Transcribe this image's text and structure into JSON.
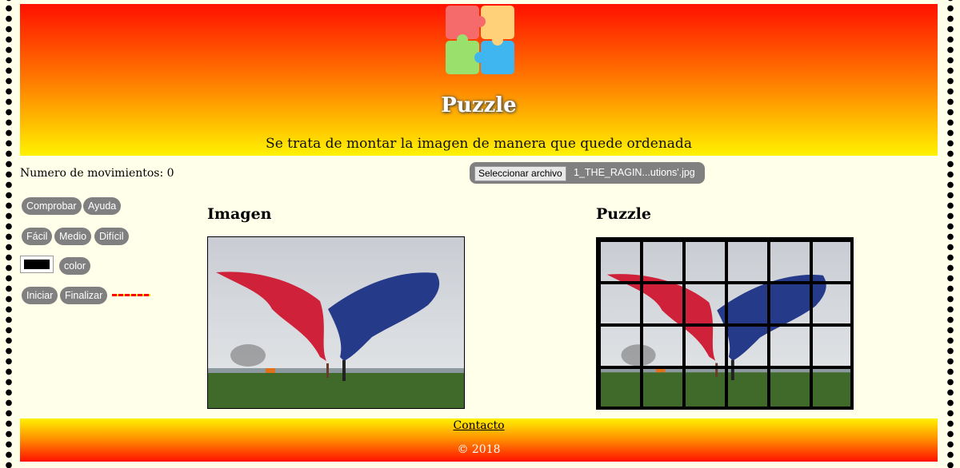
{
  "header": {
    "title": "Puzzle",
    "subtitle": "Se trata de montar la imagen de manera que quede ordenada",
    "logo_icon": "puzzle-pieces-icon"
  },
  "status": {
    "moves_text": "Numero de movimientos: 0"
  },
  "file_input": {
    "button_label": "Seleccionar archivo",
    "file_name": "1_THE_RAGIN...utions'.jpg"
  },
  "controls": {
    "check_label": "Comprobar",
    "help_label": "Ayuda",
    "easy_label": "Fácil",
    "medium_label": "Medio",
    "hard_label": "Difícil",
    "color_label": "color",
    "color_value": "#000000",
    "start_label": "Iniciar",
    "finish_label": "Finalizar"
  },
  "sections": {
    "image_heading": "Imagen",
    "puzzle_heading": "Puzzle"
  },
  "footer": {
    "contact_label": "Contacto",
    "copyright": "© 2018"
  },
  "colors": {
    "gradient_top": "#ff1000",
    "gradient_bottom": "#fff200",
    "page_bg": "#ffffea",
    "button_bg": "#808080"
  }
}
